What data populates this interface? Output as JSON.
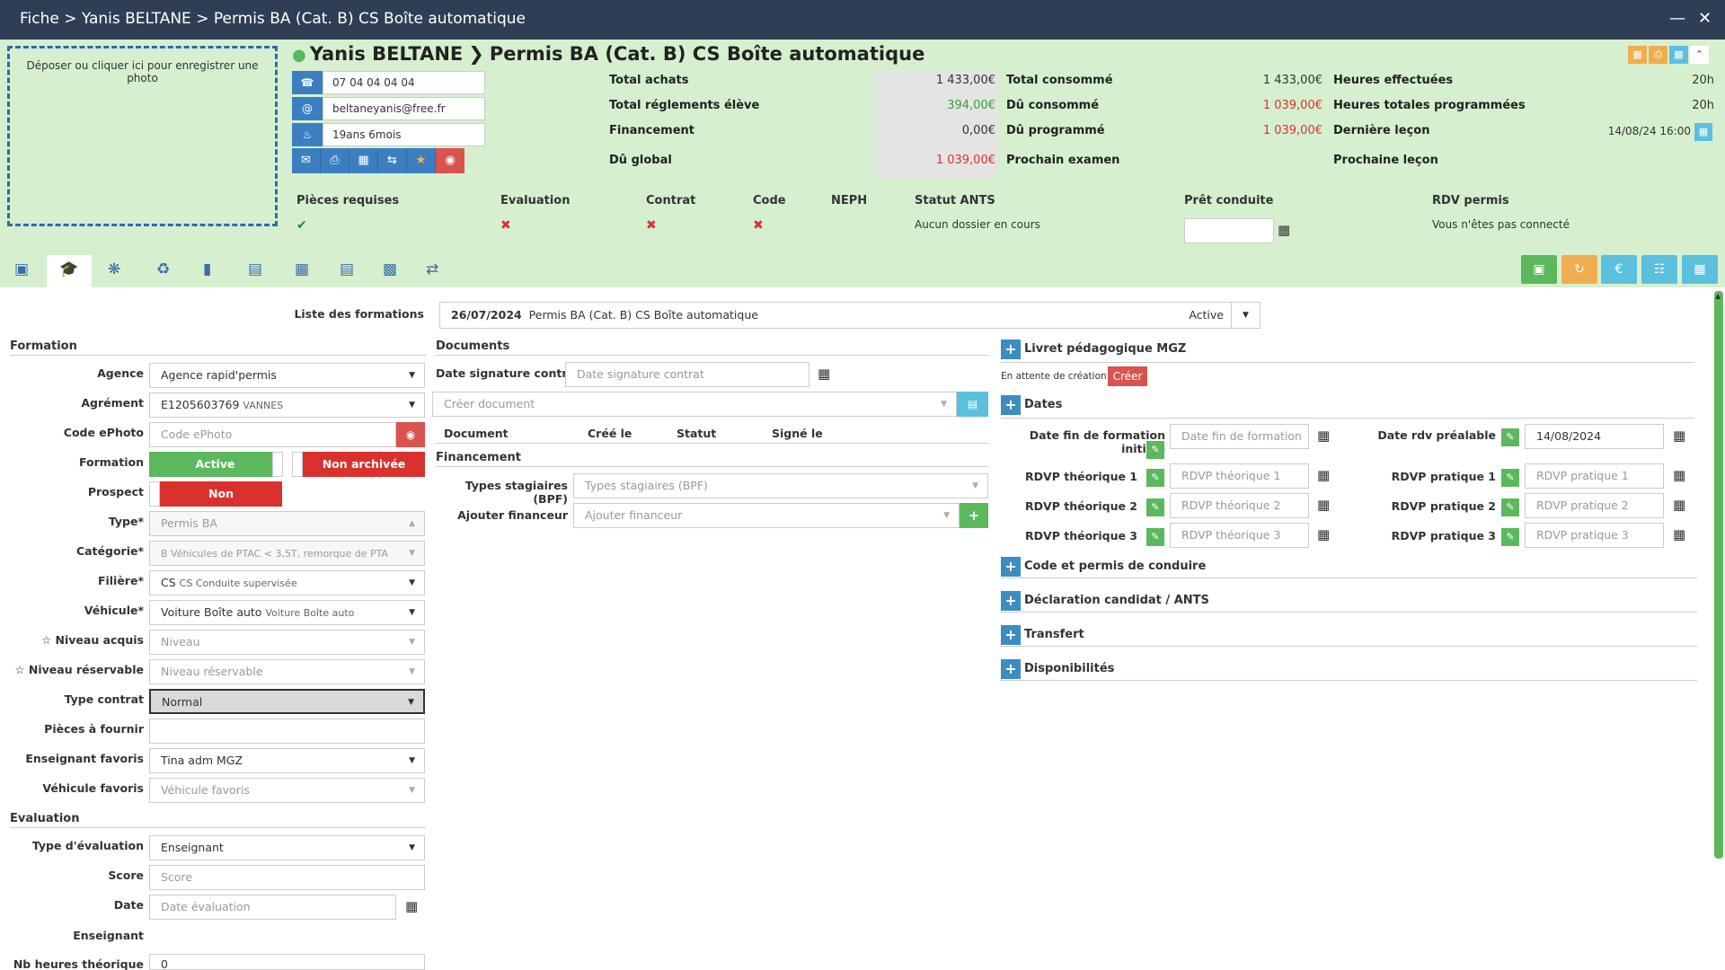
{
  "window": {
    "breadcrumb": "Fiche > Yanis BELTANE > Permis BA (Cat. B) CS Boîte automatique",
    "minimize_icon": "minus-icon",
    "close_icon": "close-icon"
  },
  "header": {
    "photo_drop_text": "Déposer ou cliquer ici pour enregistrer une photo",
    "student_name": "Yanis BELTANE",
    "formation_title": "Permis BA (Cat. B) CS Boîte automatique",
    "phone": "07 04 04 04 04",
    "email": "beltaneyanis@free.fr",
    "age": "19ans 6mois",
    "stats_col1": [
      {
        "label": "Total achats",
        "value": "1 433,00€"
      },
      {
        "label": "Total réglements élève",
        "value": "394,00€"
      },
      {
        "label": "Financement",
        "value": "0,00€"
      },
      {
        "label": "Dû global",
        "value": "1 039,00€"
      }
    ],
    "stats_col2": [
      {
        "label": "Total consommé",
        "value": "1 433,00€"
      },
      {
        "label": "Dû consommé",
        "value": "1 039,00€"
      },
      {
        "label": "Dû programmé",
        "value": "1 039,00€"
      },
      {
        "label": "Prochain examen",
        "value": ""
      }
    ],
    "stats_col3": [
      {
        "label": "Heures effectuées",
        "value": "20h"
      },
      {
        "label": "Heures totales programmées",
        "value": "20h"
      },
      {
        "label": "Dernière leçon",
        "value": "14/08/24 16:00"
      },
      {
        "label": "Prochaine leçon",
        "value": ""
      }
    ],
    "requirements": {
      "pieces_label": "Pièces requises",
      "evaluation_label": "Evaluation",
      "contrat_label": "Contrat",
      "code_label": "Code",
      "neph_label": "NEPH",
      "ants_label": "Statut ANTS",
      "ants_value": "Aucun dossier en cours",
      "pret_label": "Prêt conduite",
      "rdv_label": "RDV permis",
      "rdv_value": "Vous n'êtes pas connecté"
    }
  },
  "formation_list": {
    "label": "Liste des formations",
    "date": "26/07/2024",
    "name": "Permis BA (Cat. B) CS Boîte automatique",
    "status": "Active"
  },
  "formation": {
    "section_title": "Formation",
    "agence_label": "Agence",
    "agence_value": "Agence rapid'permis",
    "agrement_label": "Agrément",
    "agrement_value": "E1205603769",
    "agrement_city": "VANNES",
    "ephoto_label": "Code ePhoto",
    "ephoto_placeholder": "Code ePhoto",
    "formation_label": "Formation",
    "formation_active": "Active",
    "formation_archive": "Non archivée",
    "prospect_label": "Prospect",
    "prospect_value": "Non",
    "type_label": "Type*",
    "type_value": "Permis BA",
    "categorie_label": "Catégorie*",
    "categorie_value": "B",
    "categorie_desc": "B Véhicules de PTAC < 3,5T, remorque de PTA",
    "filiere_label": "Filière*",
    "filiere_value": "CS",
    "filiere_desc": "CS Conduite supervisée",
    "vehicule_label": "Véhicule*",
    "vehicule_value": "Voiture Boîte auto",
    "vehicule_desc": "Voiture Boîte auto",
    "niveau_label": "☆ Niveau acquis",
    "niveau_placeholder": "Niveau",
    "niveau_res_label": "☆ Niveau réservable",
    "niveau_res_placeholder": "Niveau réservable",
    "contrat_label": "Type contrat",
    "contrat_value": "Normal",
    "pieces_label": "Pièces à fournir",
    "enseignant_label": "Enseignant favoris",
    "enseignant_value": "Tina adm MGZ",
    "vehicule_fav_label": "Véhicule favoris",
    "vehicule_fav_placeholder": "Véhicule favoris"
  },
  "evaluation": {
    "section_title": "Evaluation",
    "type_label": "Type d'évaluation",
    "type_value": "Enseignant",
    "score_label": "Score",
    "score_placeholder": "Score",
    "date_label": "Date",
    "date_placeholder": "Date évaluation",
    "enseignant_label": "Enseignant",
    "nb_heures_label": "Nb heures théorique",
    "nb_heures_value": "0"
  },
  "documents": {
    "section_title": "Documents",
    "date_sig_label": "Date signature contrat",
    "date_sig_placeholder": "Date signature contrat",
    "creer_placeholder": "Créer document",
    "col_document": "Document",
    "col_cree": "Créé le",
    "col_statut": "Statut",
    "col_signe": "Signé le"
  },
  "financement": {
    "section_title": "Financement",
    "types_label": "Types stagiaires (BPF)",
    "types_placeholder": "Types stagiaires (BPF)",
    "ajouter_label": "Ajouter financeur",
    "ajouter_placeholder": "Ajouter financeur"
  },
  "right": {
    "livret_title": "Livret pédagogique MGZ",
    "livret_status": "En attente de création",
    "creer_label": "Créer",
    "dates_title": "Dates",
    "fin_formation_label": "Date fin de formation initiale",
    "fin_formation_placeholder": "Date fin de formation",
    "rdv_prealable_label": "Date rdv préalable",
    "rdv_prealable_value": "14/08/2024",
    "rdvp_theo": [
      {
        "label": "RDVP théorique 1",
        "placeholder": "RDVP théorique 1"
      },
      {
        "label": "RDVP théorique 2",
        "placeholder": "RDVP théorique 2"
      },
      {
        "label": "RDVP théorique 3",
        "placeholder": "RDVP théorique 3"
      }
    ],
    "rdvp_prat": [
      {
        "label": "RDVP pratique 1",
        "placeholder": "RDVP pratique 1"
      },
      {
        "label": "RDVP pratique 2",
        "placeholder": "RDVP pratique 2"
      },
      {
        "label": "RDVP pratique 3",
        "placeholder": "RDVP pratique 3"
      }
    ],
    "accordions": [
      "Code et permis de conduire",
      "Déclaration candidat / ANTS",
      "Transfert",
      "Disponibilités"
    ]
  },
  "colors": {
    "header_bg": "#d6efcf",
    "titlebar_bg": "#2f3e55",
    "accent_blue": "#3c7fc1",
    "success": "#5cb85c",
    "danger": "#d9322e",
    "warning": "#f0ad4e",
    "info": "#5bc0de"
  }
}
